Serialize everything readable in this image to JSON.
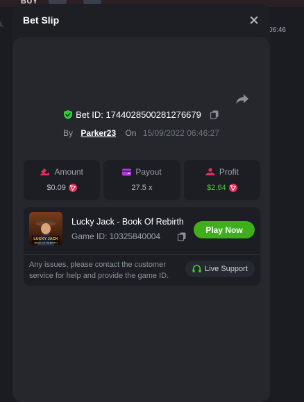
{
  "background": {
    "buy_label": "BUY",
    "time_fragment": "06:46",
    "strip_fragment": "L"
  },
  "modal": {
    "title": "Bet Slip"
  },
  "bet": {
    "id_label": "Bet ID: 1744028500281276679",
    "by_label": "By",
    "username": "Parker23",
    "on_label": "On",
    "date": "15/09/2022 06:46:27"
  },
  "stats": {
    "amount": {
      "label": "Amount",
      "value": "$0.09",
      "coin": "tron-icon"
    },
    "payout": {
      "label": "Payout",
      "value": "27.5 x"
    },
    "profit": {
      "label": "Profit",
      "value": "$2.64",
      "coin": "tron-icon",
      "color": "#43d12e"
    }
  },
  "game": {
    "title": "Lucky Jack - Book Of Rebirth",
    "game_id": "Game ID: 10325840004",
    "play_label": "Play Now",
    "thumb_text_1": "LUCKY JACK",
    "thumb_text_2": "BOOK OF REBIRTH"
  },
  "support": {
    "text": "Any issues, please contact the customer service for help and provide the game ID.",
    "button_label": "Live Support"
  },
  "colors": {
    "accent_green": "#3fae1b",
    "profit_green": "#43d12e",
    "coin_red": "#e5315a",
    "shield_green": "#2ccd3b"
  }
}
